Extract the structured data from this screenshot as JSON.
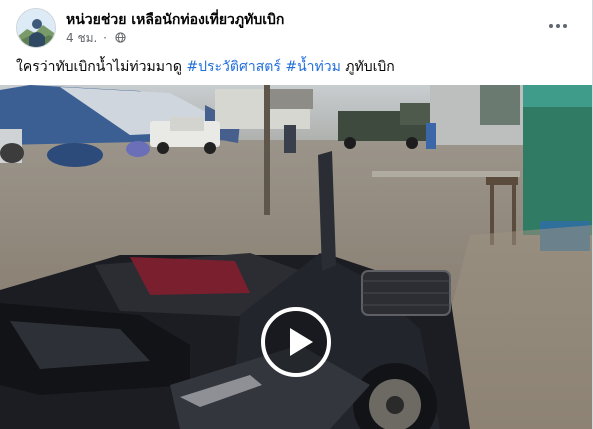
{
  "post": {
    "author": "หน่วยช่วย เหลือนักท่องเที่ยวภูทับเบิก",
    "timestamp": "4 ชม.",
    "meta_separator": "·",
    "privacy_icon": "globe-icon",
    "more_icon": "more-horizontal-icon",
    "caption": {
      "text": "ใครว่าทับเบิกน้ำไม่ท่วมมาดู",
      "hashtags": [
        "#ประวัติศาสตร์",
        "#น้ำท่วม"
      ],
      "suffix": "ภูทับเบิก"
    }
  },
  "video": {
    "play_icon": "play-icon"
  },
  "colors": {
    "hashtag": "#216fdb",
    "secondary_text": "#65676b",
    "primary_text": "#050505"
  }
}
